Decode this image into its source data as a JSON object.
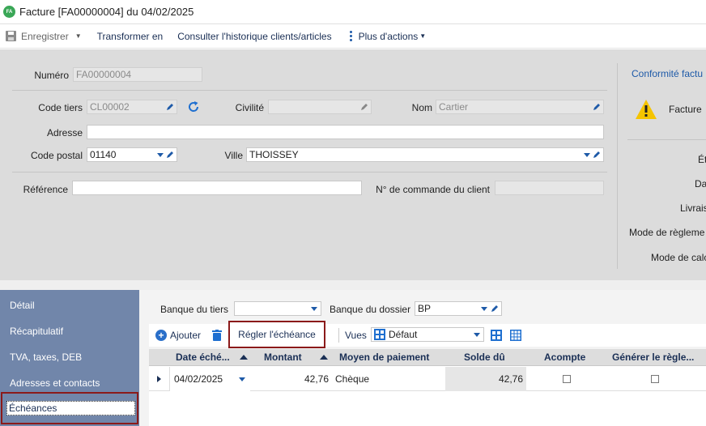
{
  "window": {
    "badge": "FA",
    "title": "Facture [FA00000004] du 04/02/2025"
  },
  "toolbar": {
    "save_label": "Enregistrer",
    "transform_label": "Transformer en",
    "history_label": "Consulter l'historique clients/articles",
    "more_label": "Plus d'actions"
  },
  "form": {
    "numero": {
      "label": "Numéro",
      "value": "FA00000004"
    },
    "code_tiers": {
      "label": "Code tiers",
      "value": "CL00002"
    },
    "civilite": {
      "label": "Civilité",
      "value": ""
    },
    "nom": {
      "label": "Nom",
      "value": "Cartier"
    },
    "adresse": {
      "label": "Adresse",
      "value": ""
    },
    "code_postal": {
      "label": "Code postal",
      "value": "01140"
    },
    "ville": {
      "label": "Ville",
      "value": "THOISSEY"
    },
    "reference": {
      "label": "Référence",
      "value": ""
    },
    "commande": {
      "label": "N° de commande du client",
      "value": ""
    }
  },
  "right_panel": {
    "conformity_link": "Conformité factu",
    "warning_text": "Facture",
    "labels": [
      "Ét",
      "Da",
      "Livrais",
      "Mode de règleme",
      "Mode de calc"
    ]
  },
  "nav": {
    "items": [
      "Détail",
      "Récapitulatif",
      "TVA, taxes, DEB",
      "Adresses et contacts"
    ],
    "active": "Échéances"
  },
  "content": {
    "banque_tiers": {
      "label": "Banque du tiers",
      "value": ""
    },
    "banque_dossier": {
      "label": "Banque du dossier",
      "value": "BP"
    },
    "add_label": "Ajouter",
    "regler_label": "Régler l'échéance",
    "vues_label": "Vues",
    "vues_value": "Défaut"
  },
  "grid": {
    "columns": [
      "Date éché...",
      "Montant",
      "Moyen de paiement",
      "Solde dû",
      "Acompte",
      "Générer le règle..."
    ],
    "rows": [
      {
        "date": "04/02/2025",
        "montant": "42,76",
        "moyen": "Chèque",
        "solde": "42,76",
        "acompte": false,
        "generer": false
      }
    ]
  }
}
